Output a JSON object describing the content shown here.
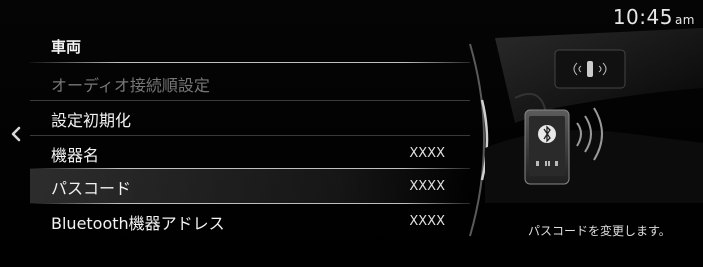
{
  "status": {
    "time": "10:45",
    "ampm": "am"
  },
  "nav": {
    "back_icon": "chevron-left-icon"
  },
  "menu": {
    "header": "車両",
    "items": [
      {
        "label": "オーディオ接続順設定",
        "value": "",
        "state": "disabled"
      },
      {
        "label": "設定初期化",
        "value": ""
      },
      {
        "label": "機器名",
        "value": "XXXX"
      },
      {
        "label": "パスコード",
        "value": "XXXX",
        "state": "selected"
      },
      {
        "label": "Bluetooth機器アドレス",
        "value": "XXXX"
      }
    ]
  },
  "panel": {
    "description": "パスコードを変更します。"
  }
}
